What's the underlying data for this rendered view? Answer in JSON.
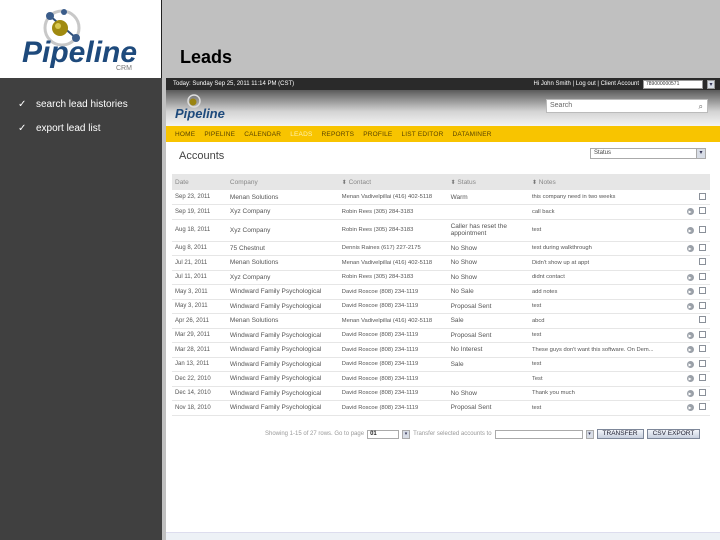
{
  "slide": {
    "title": "Leads",
    "logo_text": "Pipeline",
    "logo_suffix": "CRM",
    "bullets": [
      {
        "check": "✓",
        "text": "search lead histories"
      },
      {
        "check": "✓",
        "text": "export lead list"
      }
    ]
  },
  "app": {
    "topbar": {
      "date": "Today: Sunday Sep 25, 2011 11:14 PM (CST)",
      "greeting": "Hi John Smith | Log out | Client Account",
      "account_value": "789000000571",
      "arrow": "▾"
    },
    "search": {
      "placeholder": "Search",
      "icon": "⌕"
    },
    "nav": [
      "HOME",
      "PIPELINE",
      "CALENDAR",
      "LEADS",
      "REPORTS",
      "PROFILE",
      "LIST EDITOR",
      "DATAMINER"
    ],
    "nav_active": "LEADS",
    "accounts_title": "Accounts",
    "status_filter": {
      "value": "Status",
      "arrow": "▾"
    },
    "table": {
      "headers": [
        "Date",
        "Company",
        "Contact",
        "Status",
        "Notes"
      ],
      "sort_icon": "⬍",
      "rows": [
        {
          "date": "Sep 23, 2011",
          "company": "Menan Solutions",
          "contact": "Menan Vadivelpillai (416) 402-5118",
          "status": "Warm",
          "notes": "this company need in two weeks",
          "play": false
        },
        {
          "date": "Sep 19, 2011",
          "company": "Xyz Company",
          "contact": "Robin Rees (305) 284-3183",
          "status": "",
          "notes": "call back",
          "play": true
        },
        {
          "date": "Aug 18, 2011",
          "company": "Xyz Company",
          "contact": "Robin Rees (305) 284-3183",
          "status": "Caller has reset the appointment",
          "notes": "test",
          "play": true,
          "tall": true
        },
        {
          "date": "Aug 8, 2011",
          "company": "75 Chestnut",
          "contact": "Dennis Raines (617) 227-2175",
          "status": "No Show",
          "notes": "test during walkthrough",
          "play": true
        },
        {
          "date": "Jul 21, 2011",
          "company": "Menan Solutions",
          "contact": "Menan Vadivelpillai (416) 402-5118",
          "status": "No Show",
          "notes": "Didn't show up at appt",
          "play": false
        },
        {
          "date": "Jul 11, 2011",
          "company": "Xyz Company",
          "contact": "Robin Rees (305) 284-3183",
          "status": "No Show",
          "notes": "didnt contact",
          "play": true
        },
        {
          "date": "May 3, 2011",
          "company": "Windward Family Psychological",
          "contact": "David Roscoe (808) 234-1119",
          "status": "No Sale",
          "notes": "add notes",
          "play": true
        },
        {
          "date": "May 3, 2011",
          "company": "Windward Family Psychological",
          "contact": "David Roscoe (808) 234-1119",
          "status": "Proposal Sent",
          "notes": "test",
          "play": true
        },
        {
          "date": "Apr 26, 2011",
          "company": "Menan Solutions",
          "contact": "Menan Vadivelpillai (416) 402-5118",
          "status": "Sale",
          "notes": "abcd",
          "play": false
        },
        {
          "date": "Mar 29, 2011",
          "company": "Windward Family Psychological",
          "contact": "David Roscoe (808) 234-1119",
          "status": "Proposal Sent",
          "notes": "test",
          "play": true
        },
        {
          "date": "Mar 28, 2011",
          "company": "Windward Family Psychological",
          "contact": "David Roscoe (808) 234-1119",
          "status": "No Interest",
          "notes": "These guys don't want this software. On Dem...",
          "play": true
        },
        {
          "date": "Jan 13, 2011",
          "company": "Windward Family Psychological",
          "contact": "David Roscoe (808) 234-1119",
          "status": "Sale",
          "notes": "test",
          "play": true
        },
        {
          "date": "Dec 22, 2010",
          "company": "Windward Family Psychological",
          "contact": "David Roscoe (808) 234-1119",
          "status": "",
          "notes": "Test",
          "play": true
        },
        {
          "date": "Dec 14, 2010",
          "company": "Windward Family Psychological",
          "contact": "David Roscoe (808) 234-1119",
          "status": "No Show",
          "notes": "Thank you much",
          "play": true
        },
        {
          "date": "Nov 18, 2010",
          "company": "Windward Family Psychological",
          "contact": "David Roscoe (808) 234-1119",
          "status": "Proposal Sent",
          "notes": "test",
          "play": true
        }
      ]
    },
    "footer": {
      "showing": "Showing 1-15 of 27 rows. Go to page",
      "page_value": "01",
      "transfer_label": "Transfer selected accounts to",
      "transfer_button": "TRANSFER",
      "export_button": "CSV EXPORT",
      "arrow": "▾"
    }
  }
}
